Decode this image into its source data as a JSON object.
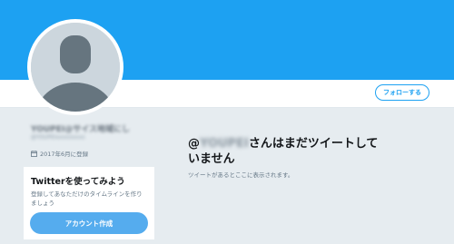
{
  "header": {
    "follow_label": "フォローする"
  },
  "profile": {
    "name": "YOUPEI@サイス地域にし",
    "handle": "@YOUPEIxxxxxxxxx",
    "joined": "2017年6月に登録"
  },
  "signup_card": {
    "title": "Twitterを使ってみよう",
    "description": "登録してあなただけのタイムラインを作りましょう",
    "button_label": "アカウント作成"
  },
  "empty_state": {
    "at": "@",
    "masked_handle": "YOUPEI",
    "title_rest": "さんはまだツイートしていません",
    "subtitle": "ツイートがあるとここに表示されます。"
  },
  "colors": {
    "banner": "#1da1f2",
    "accent": "#1da1f2",
    "button": "#55acee"
  },
  "icons": {
    "calendar": "calendar-icon",
    "avatar": "default-avatar-icon"
  }
}
